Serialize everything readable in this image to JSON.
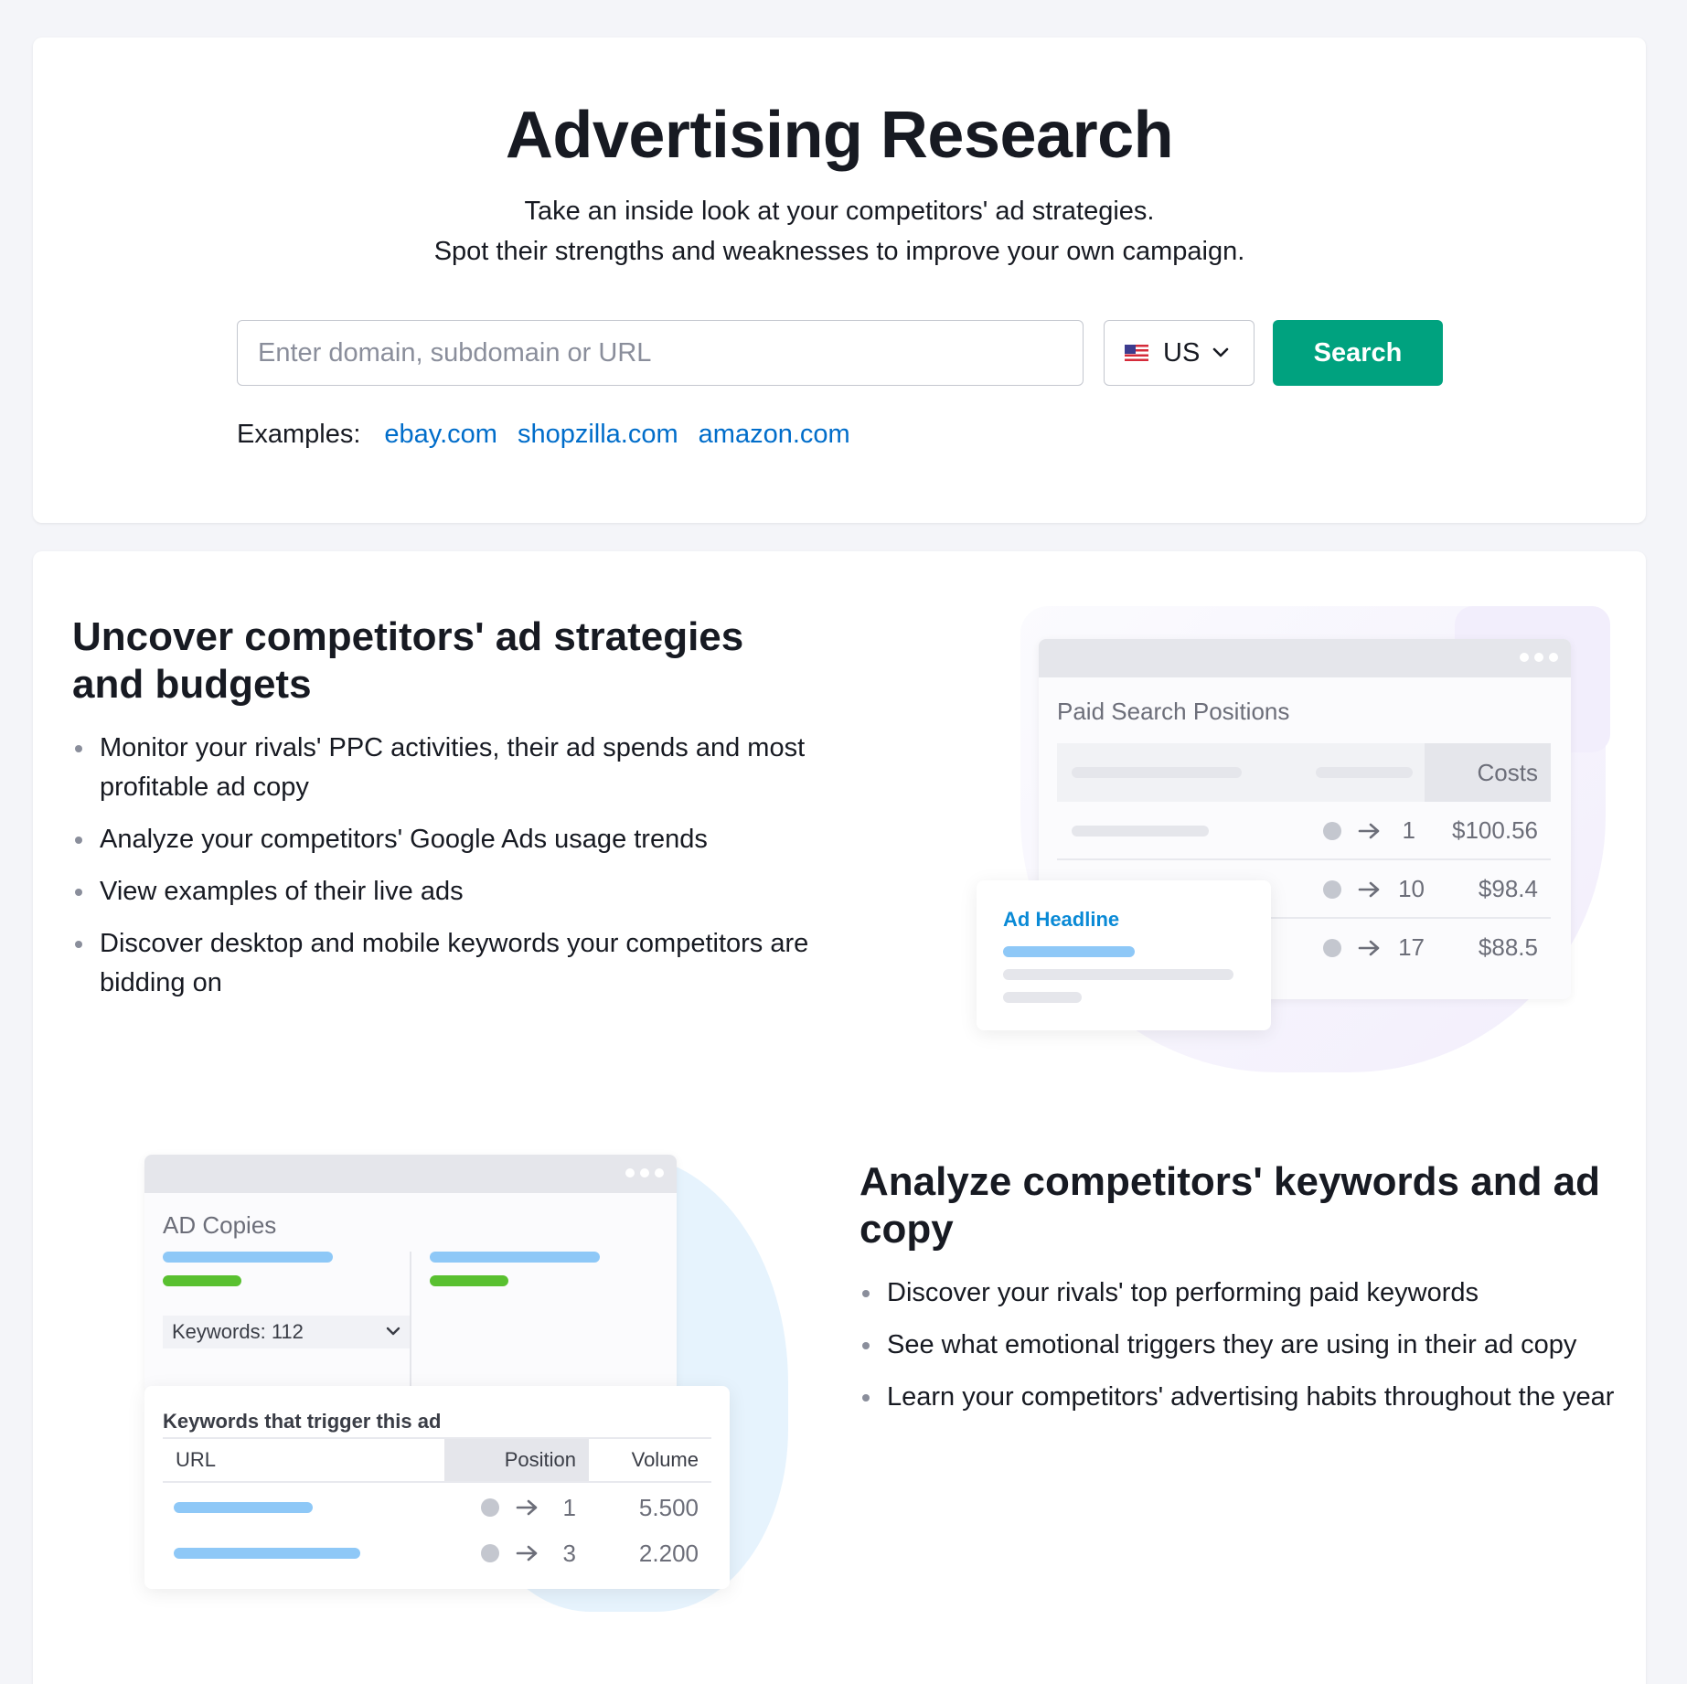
{
  "hero": {
    "title": "Advertising Research",
    "subtitle_line1": "Take an inside look at your competitors' ad strategies.",
    "subtitle_line2": "Spot their strengths and weaknesses to improve your own campaign."
  },
  "search": {
    "placeholder": "Enter domain, subdomain or URL",
    "value": "",
    "country": "US",
    "country_flag_icon": "us-flag-icon",
    "button_label": "Search",
    "button_color": "#00a27f"
  },
  "examples": {
    "label": "Examples:",
    "links": [
      "ebay.com",
      "shopzilla.com",
      "amazon.com"
    ],
    "link_color": "#006dca"
  },
  "feature1": {
    "title_line1": "Uncover competitors' ad strategies",
    "title_line2": "and budgets",
    "bullets": [
      "Monitor your rivals' PPC activities, their ad spends and most profitable ad copy",
      "Analyze your competitors' Google Ads usage trends",
      "View examples of their live ads",
      "Discover desktop and mobile keywords your competitors are bidding on"
    ],
    "illustration": {
      "window_title": "Paid Search Positions",
      "costs_header": "Costs",
      "rows": [
        {
          "position": "1",
          "cost": "$100.56"
        },
        {
          "position": "10",
          "cost": "$98.4"
        },
        {
          "position": "17",
          "cost": "$88.5"
        }
      ],
      "ad_card_label": "Ad Headline"
    }
  },
  "feature2": {
    "title_line1": "Analyze competitors' keywords and ad",
    "title_line2": "copy",
    "bullets": [
      "Discover your rivals' top performing paid keywords",
      "See what emotional triggers they are using in their ad copy",
      "Learn your competitors' advertising habits throughout the year"
    ],
    "illustration": {
      "window_title": "AD Copies",
      "keywords_select": "Keywords: 112",
      "table_title": "Keywords that trigger this ad",
      "columns": [
        "URL",
        "Position",
        "Volume"
      ],
      "rows": [
        {
          "position": "1",
          "volume": "5.500"
        },
        {
          "position": "3",
          "volume": "2.200"
        }
      ]
    }
  }
}
